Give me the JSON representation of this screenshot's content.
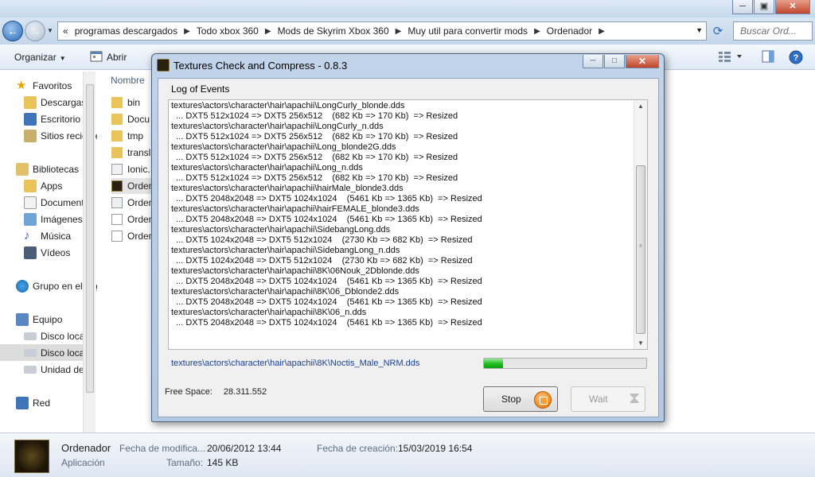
{
  "explorer": {
    "window_buttons": {
      "min": "─",
      "max": "▣",
      "close": "✕"
    },
    "address": {
      "overflow": "«",
      "crumbs": [
        "programas descargados",
        "Todo xbox 360",
        "Mods de Skyrim Xbox 360",
        "Muy util para convertir mods",
        "Ordenador"
      ]
    },
    "search_placeholder": "Buscar Ord...",
    "toolbar": {
      "organize": "Organizar",
      "open": "Abrir"
    },
    "column_header": "Nombre",
    "nav": {
      "favorites": "Favoritos",
      "fav_items": [
        "Descargas",
        "Escritorio",
        "Sitios recientes"
      ],
      "libraries": "Bibliotecas",
      "lib_items": [
        "Apps",
        "Documentos",
        "Imágenes",
        "Música",
        "Vídeos"
      ],
      "homegroup": "Grupo en el hogar",
      "computer": "Equipo",
      "comp_items": [
        "Disco local",
        "Disco local",
        "Unidad de"
      ],
      "network": "Red"
    },
    "files": [
      "bin",
      "Docu",
      "tmp",
      "transl",
      "Ionic.",
      "Orden",
      "Orden",
      "Orden",
      "Orden"
    ],
    "details": {
      "name": "Ordenador",
      "type": "Aplicación",
      "modified_label": "Fecha de modifica...",
      "modified_value": "20/06/2012 13:44",
      "created_label": "Fecha de creación:",
      "created_value": "15/03/2019 16:54",
      "size_label": "Tamaño:",
      "size_value": "145 KB"
    }
  },
  "dialog": {
    "title": "Textures Check and Compress - 0.8.3",
    "group_label": "Log of Events",
    "log": [
      "textures\\actors\\character\\hair\\apachii\\LongCurly_blonde.dds",
      "  ... DXT5 512x1024 => DXT5 256x512    (682 Kb => 170 Kb)  => Resized",
      "textures\\actors\\character\\hair\\apachii\\LongCurly_n.dds",
      "  ... DXT5 512x1024 => DXT5 256x512    (682 Kb => 170 Kb)  => Resized",
      "textures\\actors\\character\\hair\\apachii\\Long_blonde2G.dds",
      "  ... DXT5 512x1024 => DXT5 256x512    (682 Kb => 170 Kb)  => Resized",
      "textures\\actors\\character\\hair\\apachii\\Long_n.dds",
      "  ... DXT5 512x1024 => DXT5 256x512    (682 Kb => 170 Kb)  => Resized",
      "textures\\actors\\character\\hair\\apachii\\hairMale_blonde3.dds",
      "  ... DXT5 2048x2048 => DXT5 1024x1024    (5461 Kb => 1365 Kb)  => Resized",
      "textures\\actors\\character\\hair\\apachii\\hairFEMALE_blonde3.dds",
      "  ... DXT5 2048x2048 => DXT5 1024x1024    (5461 Kb => 1365 Kb)  => Resized",
      "textures\\actors\\character\\hair\\apachii\\SidebangLong.dds",
      "  ... DXT5 1024x2048 => DXT5 512x1024    (2730 Kb => 682 Kb)  => Resized",
      "textures\\actors\\character\\hair\\apachii\\SidebangLong_n.dds",
      "  ... DXT5 1024x2048 => DXT5 512x1024    (2730 Kb => 682 Kb)  => Resized",
      "textures\\actors\\character\\hair\\apachii\\8K\\06Nouk_2Dblonde.dds",
      "  ... DXT5 2048x2048 => DXT5 1024x1024    (5461 Kb => 1365 Kb)  => Resized",
      "textures\\actors\\character\\hair\\apachii\\8K\\06_Dblonde2.dds",
      "  ... DXT5 2048x2048 => DXT5 1024x1024    (5461 Kb => 1365 Kb)  => Resized",
      "textures\\actors\\character\\hair\\apachii\\8K\\06_n.dds",
      "  ... DXT5 2048x2048 => DXT5 1024x1024    (5461 Kb => 1365 Kb)  => Resized"
    ],
    "current_file": "textures\\actors\\character\\hair\\apachii\\8K\\Noctis_Male_NRM.dds",
    "progress_fraction": 0.12,
    "free_space_label": "Free Space:",
    "free_space_value": "28.311.552",
    "stop_label": "Stop",
    "wait_label": "Wait"
  }
}
